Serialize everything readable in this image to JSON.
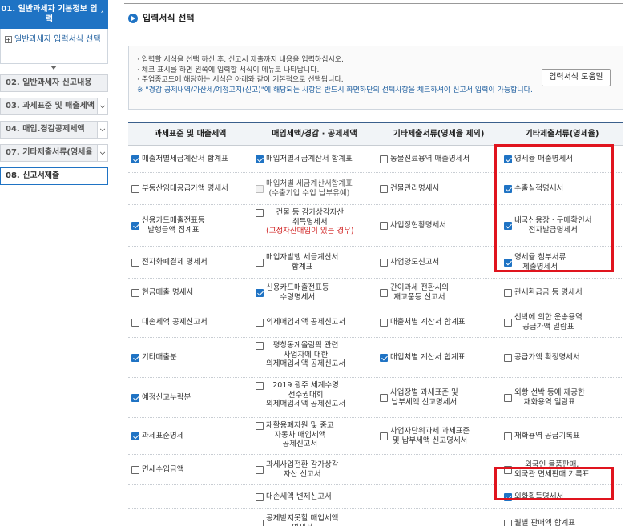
{
  "sidebar": {
    "header": "01. 일반과세자 기본정보 입력",
    "sub_item": "일반과세자 입력서식 선택",
    "items": [
      {
        "label": "02. 일반과세자 신고내용"
      },
      {
        "label": "03. 과세표준 및 매출세액"
      },
      {
        "label": "04. 매입.경감공제세액"
      },
      {
        "label": "07. 기타제출서류(영세율"
      },
      {
        "label": "08. 신고서제출"
      }
    ]
  },
  "page_title": "입력서식 선택",
  "notice": {
    "lines": [
      "· 입력할 서식을 선택 하신 후, 신고서 제출까지 내용을 입력하십시오.",
      "· 체크 표시를 하면 왼쪽에 입력할 서식이 메뉴로 나타납니다.",
      "· 주업종코드에 해당하는 서식은 아래와 같이 기본적으로 선택됩니다.",
      "※ \"경감.공제내역/가산세/예정고지(신고)\"에 해당되는 사항은 반드시 화면하단의 선택사항을 체크하셔야 신고서 입력이 가능합니다."
    ],
    "help_button": "입력서식 도움말"
  },
  "table": {
    "headers": [
      "과세표준 및 매출세액",
      "매입세액/경감 · 공제세액",
      "기타제출서류(영세율 제외)",
      "기타제출서류(영세율)"
    ],
    "rows": [
      {
        "h": 34,
        "c": [
          {
            "t": "매출처별세금계산서 합계표",
            "ck": true
          },
          {
            "t": "매입처별세금계산서 합계표",
            "ck": true
          },
          {
            "t": "동물진료용역 매출명세서",
            "ck": false
          },
          {
            "t": "영세율 매출명세서",
            "ck": true
          }
        ]
      },
      {
        "h": 40,
        "c": [
          {
            "t": "부동산임대공급가액 명세서",
            "ck": false
          },
          {
            "t": "매입처별 세금계산서합계표\n(수출기업 수입 납부유예)",
            "ck": false,
            "dis": true
          },
          {
            "t": "건물관리명세서",
            "ck": false
          },
          {
            "t": "수출실적명세서",
            "ck": true
          }
        ]
      },
      {
        "h": 52,
        "c": [
          {
            "t": "신용카드매출전표등\n발행금액 집계표",
            "ck": true
          },
          {
            "t": "건물 등 감가상각자산\n취득명세서",
            "red": "(고정자산매입이 있는 경우)",
            "ck": false
          },
          {
            "t": "사업장현황명세서",
            "ck": false
          },
          {
            "t": "내국신용장 · 구매확인서\n전자발급명세서",
            "ck": true
          }
        ]
      },
      {
        "h": 40,
        "c": [
          {
            "t": "전자화폐결제 명세서",
            "ck": false
          },
          {
            "t": "매입자발행 세금계산서\n합계표",
            "ck": false
          },
          {
            "t": "사업양도신고서",
            "ck": false
          },
          {
            "t": "영세율 첨부서류\n제출명세서",
            "ck": true
          }
        ]
      },
      {
        "h": 36,
        "c": [
          {
            "t": "현금매출 명세서",
            "ck": false
          },
          {
            "t": "신용카드매출전표등\n수령명세서",
            "ck": true
          },
          {
            "t": "간이과세 전환시의\n재고품등 신고서",
            "ck": false
          },
          {
            "t": "관세환급금 등 명세서",
            "ck": false
          }
        ]
      },
      {
        "h": 38,
        "c": [
          {
            "t": "대손세액 공제신고서",
            "ck": false
          },
          {
            "t": "의제매입세액 공제신고서",
            "ck": false
          },
          {
            "t": "매출처별 계산서 합계표",
            "ck": false
          },
          {
            "t": "선박에 의한 운송용역\n공급가액 일람표",
            "ck": false
          }
        ]
      },
      {
        "h": 50,
        "c": [
          {
            "t": "기타매출분",
            "ck": true
          },
          {
            "t": "평창동계올림픽 관련\n사업자에 대한\n의제매입세액 공제신고서",
            "ck": false
          },
          {
            "t": "매입처별 계산서 합계표",
            "ck": true
          },
          {
            "t": "공급가액 확정명세서",
            "ck": false
          }
        ]
      },
      {
        "h": 50,
        "c": [
          {
            "t": "예정신고누락분",
            "ck": true
          },
          {
            "t": "2019 광주 세계수영\n선수권대회\n의제매입세액 공제신고서",
            "ck": false
          },
          {
            "t": "사업장별 과세표준 및\n납부세액 신고명세서",
            "ck": false
          },
          {
            "t": "외항 선박 등에 제공한\n재화용역 일람표",
            "ck": false
          }
        ]
      },
      {
        "h": 46,
        "c": [
          {
            "t": "과세표준명세",
            "ck": true
          },
          {
            "t": "재활용폐자원 및 중고\n자동차 매입세액\n공제신고서",
            "ck": false
          },
          {
            "t": "사업자단위과세 과세표준\n및 납부세액 신고명세서",
            "ck": false
          },
          {
            "t": "재화용역 공급기록표",
            "ck": false
          }
        ]
      },
      {
        "h": 38,
        "c": [
          {
            "t": "면세수입금액",
            "ck": false
          },
          {
            "t": "과세사업전환 감가상각\n자산 신고서",
            "ck": false
          },
          {
            "t": "",
            "ck": null
          },
          {
            "t": "외국인 물품판매,\n외국관 면세판매 기록표",
            "ck": false
          }
        ]
      },
      {
        "h": 30,
        "c": [
          {
            "t": "",
            "ck": null
          },
          {
            "t": "대손세액 변제신고서",
            "ck": false
          },
          {
            "t": "",
            "ck": null
          },
          {
            "t": "외화획득명세서",
            "ck": true
          }
        ]
      },
      {
        "h": 36,
        "c": [
          {
            "t": "",
            "ck": null
          },
          {
            "t": "공제받지못할 매입세액\n명세서",
            "ck": false
          },
          {
            "t": "",
            "ck": null
          },
          {
            "t": "월별 판매액 합계표",
            "ck": false
          }
        ]
      }
    ]
  },
  "colors": {
    "accent": "#1f73c4",
    "highlight": "#e0141e"
  }
}
